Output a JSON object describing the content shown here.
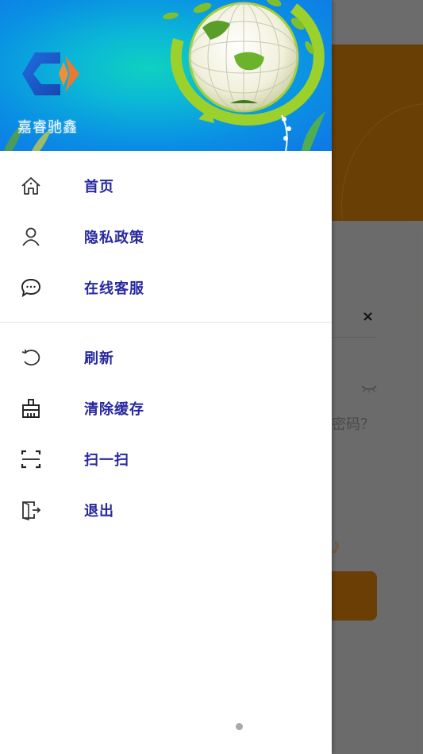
{
  "drawer": {
    "brand_name": "嘉睿驰鑫",
    "logo_colors": {
      "primary": "#1c5fd1",
      "accent": "#f2772c"
    },
    "menu_primary": [
      {
        "id": "home",
        "icon": "home-icon",
        "label": "首页"
      },
      {
        "id": "privacy",
        "icon": "user-icon",
        "label": "隐私政策"
      },
      {
        "id": "support",
        "icon": "chat-bubble-icon",
        "label": "在线客服"
      }
    ],
    "menu_secondary": [
      {
        "id": "refresh",
        "icon": "refresh-icon",
        "label": "刷新"
      },
      {
        "id": "clear-cache",
        "icon": "broom-icon",
        "label": "清除缓存"
      },
      {
        "id": "scan",
        "icon": "scan-icon",
        "label": "扫一扫"
      },
      {
        "id": "logout",
        "icon": "exit-door-icon",
        "label": "退出"
      }
    ],
    "label_color": "#2828a0"
  },
  "background_page": {
    "close_symbol": "×",
    "forgot_password_fragment": "密码？",
    "agreement_fragment": "》",
    "accent_color": "#f39b17"
  }
}
